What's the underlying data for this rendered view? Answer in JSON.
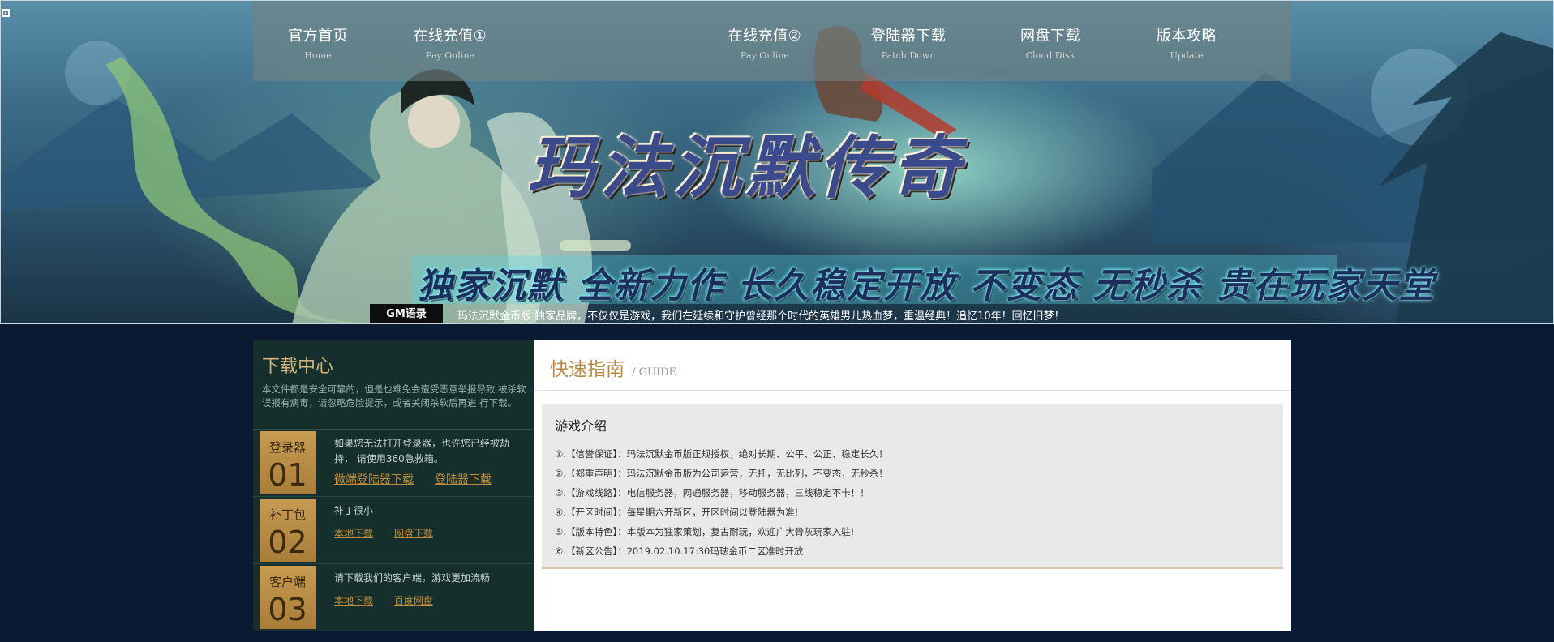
{
  "nav": [
    {
      "label": "官方首页",
      "sub": "Home"
    },
    {
      "label": "在线充值①",
      "sub": "Pay Online"
    },
    {
      "label": "在线充值②",
      "sub": "Pay Online"
    },
    {
      "label": "登陆器下载",
      "sub": "Patch Down"
    },
    {
      "label": "网盘下载",
      "sub": "Cloud Disk"
    },
    {
      "label": "版本攻略",
      "sub": "Update"
    }
  ],
  "banner": {
    "title": "玛法沉默传奇",
    "slogan": "独家沉默 全新力作 长久稳定开放 不变态 无秒杀 贵在玩家天堂"
  },
  "gm": {
    "label": "GM语录",
    "text": "玛法沉默金币版 独家品牌，不仅仅是游戏，我们在延续和守护曾经那个时代的英雄男儿热血梦，重温经典！追忆10年！回忆旧梦！"
  },
  "download": {
    "title": "下载中心",
    "desc": "本文件都是安全可靠的，但是也难免会遭受恶意举报导致 被杀软误报有病毒，请忽略危险提示，或者关闭杀软后再进 行下载。",
    "rows": [
      {
        "label": "登录器",
        "num": "01",
        "desc": "如果您无法打开登录器，也许您已经被劫持， 请使用360急救箱。",
        "links": [
          "微端登陆器下载",
          "登陆器下载"
        ]
      },
      {
        "label": "补丁包",
        "num": "02",
        "desc": "补丁很小",
        "links": [
          "本地下载",
          "网盘下载"
        ]
      },
      {
        "label": "客户端",
        "num": "03",
        "desc": "请下载我们的客户端，游戏更加流畅",
        "links": [
          "本地下载",
          "百度网盘"
        ]
      }
    ]
  },
  "guide": {
    "title": "快速指南",
    "sub": "/ GUIDE",
    "intro_title": "游戏介绍",
    "items": [
      "①.【信誉保证】：玛法沉默金币版正规授权，绝对长期、公平、公正、稳定长久！",
      "②.【郑重声明】：玛法沉默金币版为公司运营，无托，无比列，不变态，无秒杀！",
      "③.【游戏线路】：电信服务器，网通服务器，移动服务器，三线稳定不卡！！",
      "④.【开区时间】：每星期六开新区，开区时间以登陆器为准!",
      "⑤.【版本特色】：本版本为独家策划，复古耐玩，欢迎广大骨灰玩家入驻!",
      "⑥.【新区公告】：2019.02.10.17:30玛珐金币二区准时开放"
    ]
  },
  "colors": {
    "page_bg": "#0a1a33",
    "panel_dark": "#15302c",
    "badge_gold": "#b88a45",
    "link_gold": "#c08c3c",
    "guide_title": "#b58a45"
  }
}
